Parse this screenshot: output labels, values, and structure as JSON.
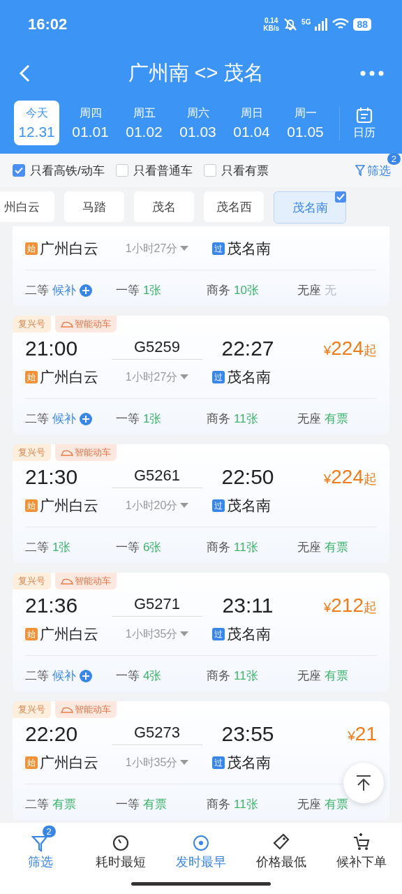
{
  "status_bar": {
    "time": "16:02",
    "speed_value": "0.14",
    "speed_unit": "KB/s",
    "network": "5G",
    "battery": "88"
  },
  "header": {
    "title": "广州南 <> 茂名"
  },
  "dates": [
    {
      "weekday": "今天",
      "date": "12.31",
      "selected": true
    },
    {
      "weekday": "周四",
      "date": "01.01",
      "selected": false
    },
    {
      "weekday": "周五",
      "date": "01.02",
      "selected": false
    },
    {
      "weekday": "周六",
      "date": "01.03",
      "selected": false
    },
    {
      "weekday": "周日",
      "date": "01.04",
      "selected": false
    },
    {
      "weekday": "周一",
      "date": "01.05",
      "selected": false
    }
  ],
  "calendar_label": "日历",
  "filters": [
    {
      "label": "只看高铁/动车",
      "checked": true
    },
    {
      "label": "只看普通车",
      "checked": false
    },
    {
      "label": "只看有票",
      "checked": false
    }
  ],
  "filter_button": {
    "label": "筛选",
    "badge": "2"
  },
  "stations": [
    {
      "name": "州白云",
      "selected": false
    },
    {
      "name": "马踏",
      "selected": false
    },
    {
      "name": "茂名",
      "selected": false
    },
    {
      "name": "茂名西",
      "selected": false
    },
    {
      "name": "茂名南",
      "selected": true
    }
  ],
  "trains": [
    {
      "from_tag": "始",
      "from": "广州白云",
      "duration": "1小时27分",
      "to_tag": "过",
      "to": "茂名南",
      "seats": [
        {
          "class": "二等",
          "value": "候补",
          "kind": "waitlist"
        },
        {
          "class": "一等",
          "value": "1张",
          "kind": "tickets"
        },
        {
          "class": "商务",
          "value": "10张",
          "kind": "tickets"
        },
        {
          "class": "无座",
          "value": "无",
          "kind": "none"
        }
      ]
    },
    {
      "tags": [
        "复兴号",
        "智能动车"
      ],
      "depart": "21:00",
      "number": "G5259",
      "arrive": "22:27",
      "currency": "¥",
      "price": "224",
      "suffix": "起",
      "from_tag": "始",
      "from": "广州白云",
      "duration": "1小时27分",
      "to_tag": "过",
      "to": "茂名南",
      "seats": [
        {
          "class": "二等",
          "value": "候补",
          "kind": "waitlist"
        },
        {
          "class": "一等",
          "value": "1张",
          "kind": "tickets"
        },
        {
          "class": "商务",
          "value": "11张",
          "kind": "tickets"
        },
        {
          "class": "无座",
          "value": "有票",
          "kind": "tickets"
        }
      ]
    },
    {
      "tags": [
        "复兴号",
        "智能动车"
      ],
      "depart": "21:30",
      "number": "G5261",
      "arrive": "22:50",
      "currency": "¥",
      "price": "224",
      "suffix": "起",
      "from_tag": "始",
      "from": "广州白云",
      "duration": "1小时20分",
      "to_tag": "过",
      "to": "茂名南",
      "seats": [
        {
          "class": "二等",
          "value": "1张",
          "kind": "tickets"
        },
        {
          "class": "一等",
          "value": "6张",
          "kind": "tickets"
        },
        {
          "class": "商务",
          "value": "11张",
          "kind": "tickets"
        },
        {
          "class": "无座",
          "value": "有票",
          "kind": "tickets"
        }
      ]
    },
    {
      "tags": [
        "复兴号",
        "智能动车"
      ],
      "depart": "21:36",
      "number": "G5271",
      "arrive": "23:11",
      "currency": "¥",
      "price": "212",
      "suffix": "起",
      "from_tag": "始",
      "from": "广州白云",
      "duration": "1小时35分",
      "to_tag": "过",
      "to": "茂名南",
      "seats": [
        {
          "class": "二等",
          "value": "候补",
          "kind": "waitlist"
        },
        {
          "class": "一等",
          "value": "4张",
          "kind": "tickets"
        },
        {
          "class": "商务",
          "value": "11张",
          "kind": "tickets"
        },
        {
          "class": "无座",
          "value": "有票",
          "kind": "tickets"
        }
      ]
    },
    {
      "tags": [
        "复兴号",
        "智能动车"
      ],
      "depart": "22:20",
      "number": "G5273",
      "arrive": "23:55",
      "currency": "¥",
      "price": "21",
      "from_tag": "始",
      "from": "广州白云",
      "duration": "1小时35分",
      "to_tag": "过",
      "to": "茂名南",
      "seats": [
        {
          "class": "二等",
          "value": "有票",
          "kind": "tickets"
        },
        {
          "class": "一等",
          "value": "有票",
          "kind": "tickets"
        },
        {
          "class": "商务",
          "value": "11张",
          "kind": "tickets"
        },
        {
          "class": "无座",
          "value": "有票",
          "kind": "tickets"
        }
      ]
    }
  ],
  "bottom_nav": [
    {
      "label": "筛选",
      "kind": "filter",
      "badge": "2",
      "selected": true
    },
    {
      "label": "耗时最短",
      "kind": "timer",
      "selected": false
    },
    {
      "label": "发时最早",
      "kind": "clock24",
      "selected": true
    },
    {
      "label": "价格最低",
      "kind": "tag",
      "selected": false
    },
    {
      "label": "候补下单",
      "kind": "cart",
      "selected": false
    }
  ]
}
